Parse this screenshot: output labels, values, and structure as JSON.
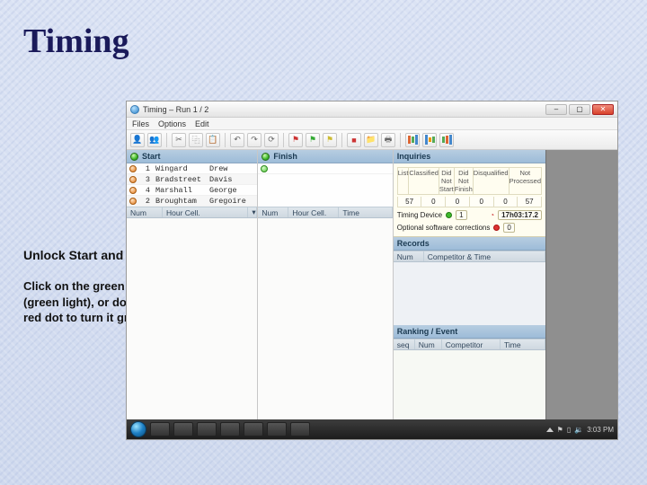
{
  "slide": {
    "title": "Timing",
    "subhead": "Unlock Start and Finish:",
    "body": "Click on the green circle icon (green light), or double click on red dot to turn it green"
  },
  "window": {
    "title": "Timing – Run 1 / 2",
    "menu": {
      "files": "Files",
      "options": "Options",
      "edit": "Edit"
    },
    "close_glyph": "✕"
  },
  "start": {
    "header": "Start",
    "cols": {
      "num": "Num",
      "hour": "Hour Cell."
    },
    "rows": [
      {
        "n": "1",
        "last": "Wingard",
        "first": "Drew"
      },
      {
        "n": "3",
        "last": "Bradstreet",
        "first": "Davis"
      },
      {
        "n": "4",
        "last": "Marshall",
        "first": "George"
      },
      {
        "n": "2",
        "last": "Broughtam",
        "first": "Gregoire"
      }
    ]
  },
  "finish": {
    "header": "Finish",
    "cols": {
      "num": "Num",
      "hour": "Hour Cell.",
      "time": "Time"
    }
  },
  "inquiries": {
    "header": "Inquiries",
    "stats_labels": {
      "list": "List",
      "classified": "Classified",
      "dns": "Did Not Start",
      "dnf": "Did Not Finish",
      "dq": "Disqualified",
      "np": "Not Processed"
    },
    "stats_values": {
      "list": "57",
      "classified": "0",
      "dns": "0",
      "dnf": "0",
      "dq": "0",
      "np": "57"
    },
    "timing_device_label": "Timing Device",
    "timing_device_count": "1",
    "current_time": "17h03:17.2",
    "optional_corrections_label": "Optional software corrections",
    "optional_corrections_count": "0"
  },
  "records": {
    "header": "Records",
    "cols": {
      "num": "Num",
      "competitor_time": "Competitor & Time"
    }
  },
  "ranking": {
    "header": "Ranking / Event",
    "cols": {
      "seq": "seq",
      "num": "Num",
      "competitor": "Competitor",
      "time": "Time"
    }
  },
  "taskbar": {
    "time": "3:03 PM"
  }
}
